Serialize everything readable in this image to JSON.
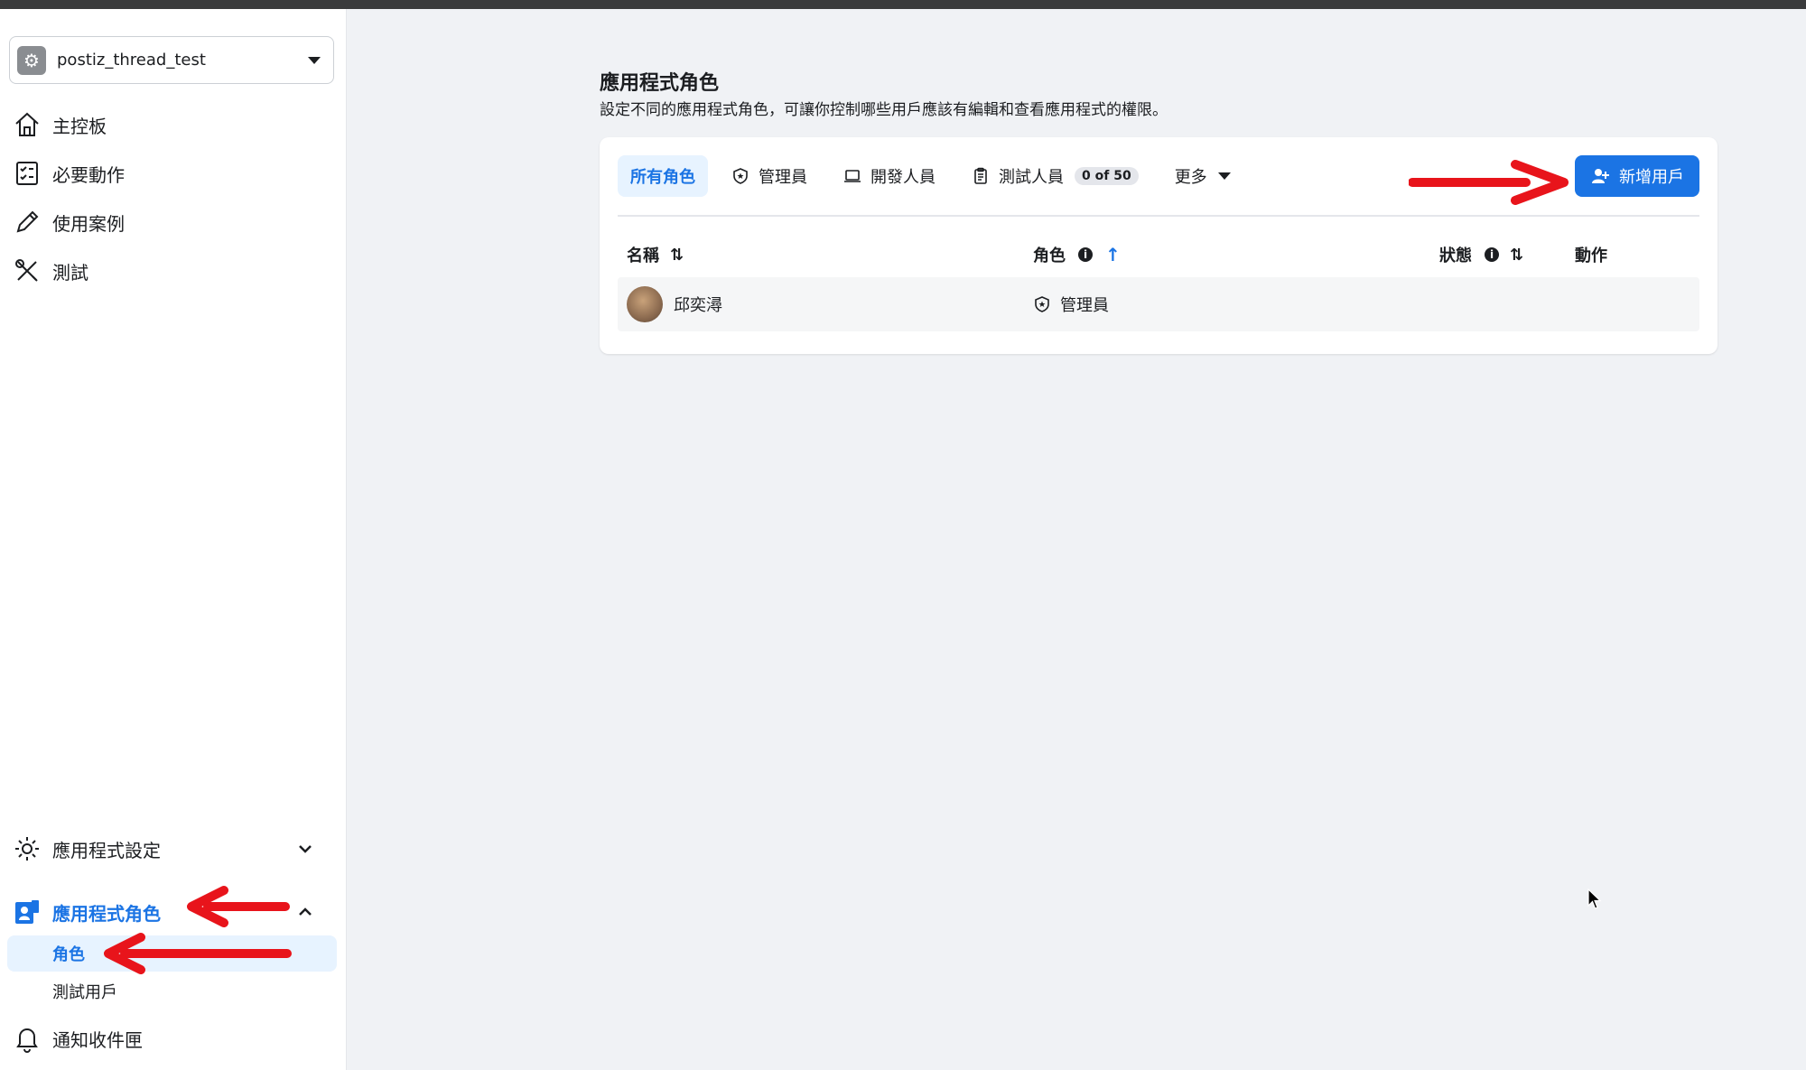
{
  "app_selector": {
    "name": "postiz_thread_test"
  },
  "sidebar": {
    "items": [
      {
        "label": "主控板",
        "icon": "home-icon"
      },
      {
        "label": "必要動作",
        "icon": "checklist-icon"
      },
      {
        "label": "使用案例",
        "icon": "pencil-icon"
      },
      {
        "label": "測試",
        "icon": "tools-icon"
      }
    ],
    "bottom_items": {
      "app_settings": {
        "label": "應用程式設定",
        "icon": "gear-icon"
      },
      "app_roles": {
        "label": "應用程式角色",
        "icon": "roles-icon"
      },
      "roles": {
        "label": "角色"
      },
      "test_users": {
        "label": "測試用戶"
      },
      "notifications": {
        "label": "通知收件匣",
        "icon": "bell-icon"
      }
    }
  },
  "main": {
    "title": "應用程式角色",
    "description": "設定不同的應用程式角色，可讓你控制哪些用戶應該有編輯和查看應用程式的權限。",
    "tabs": [
      {
        "label": "所有角色",
        "active": true
      },
      {
        "label": "管理員",
        "icon": "shield-star-icon"
      },
      {
        "label": "開發人員",
        "icon": "laptop-icon"
      },
      {
        "label": "測試人員",
        "icon": "clipboard-icon",
        "badge": "0 of 50"
      },
      {
        "label": "更多",
        "icon": "caret-down-icon"
      }
    ],
    "add_button": "新增用戶",
    "columns": [
      "名稱",
      "角色",
      "狀態",
      "動作"
    ],
    "rows": [
      {
        "name": "邱奕潯",
        "role": "管理員",
        "status": "",
        "action": ""
      }
    ]
  },
  "colors": {
    "accent": "#1b74e4",
    "annotation_arrow": "#e8141b"
  }
}
